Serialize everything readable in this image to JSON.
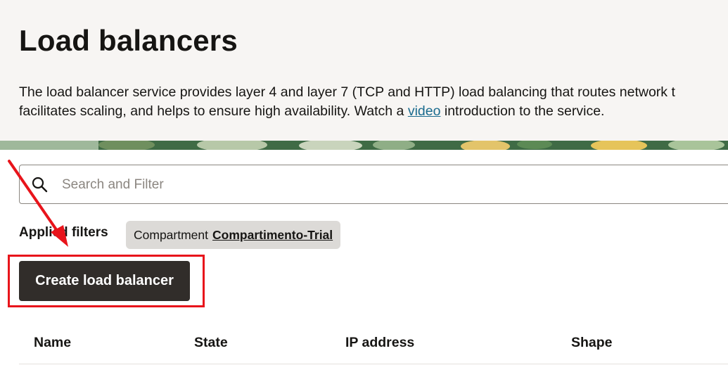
{
  "header": {
    "title": "Load balancers",
    "description_before_link": "The load balancer service provides layer 4 and layer 7 (TCP and HTTP) load balancing that routes network t",
    "description_line2_before_link": "facilitates scaling, and helps to ensure high availability. Watch a ",
    "video_link": "video",
    "description_after_link": " introduction to the service."
  },
  "search": {
    "placeholder": "Search and Filter",
    "icon": "search-icon"
  },
  "filters": {
    "label": "Applied filters",
    "chip_key": "Compartment",
    "chip_value": "Compartimento-Trial"
  },
  "actions": {
    "create_label": "Create load balancer"
  },
  "table": {
    "columns": [
      "Name",
      "State",
      "IP address",
      "Shape"
    ]
  },
  "colors": {
    "primary_button": "#312d2a",
    "annotation": "#e8141b",
    "link": "#1a6b8e",
    "hero_bg": "#f7f5f3"
  }
}
